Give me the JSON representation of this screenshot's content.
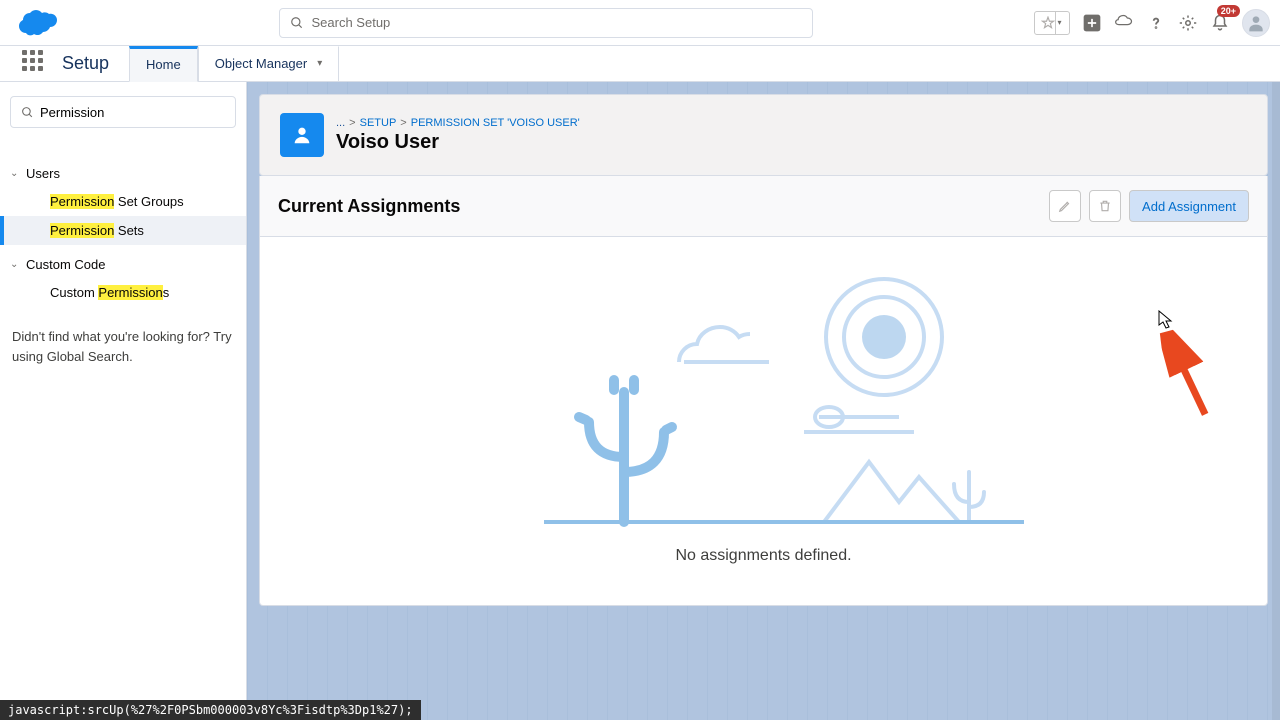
{
  "header": {
    "search_placeholder": "Search Setup",
    "notification_badge": "20+"
  },
  "nav": {
    "app_name": "Setup",
    "tabs": {
      "home": "Home",
      "object_manager": "Object Manager"
    }
  },
  "sidebar": {
    "filter_value": "Permission",
    "groups": {
      "users": {
        "label": "Users",
        "items": [
          "Permission Set Groups",
          "Permission Sets"
        ]
      },
      "custom_code": {
        "label": "Custom Code",
        "items": [
          "Custom Permissions"
        ]
      }
    },
    "hint": "Didn't find what you're looking for? Try using Global Search."
  },
  "page": {
    "breadcrumb": {
      "root": "...",
      "setup": "SETUP",
      "parent": "PERMISSION SET 'VOISO USER'"
    },
    "title": "Voiso User",
    "panel_title": "Current Assignments",
    "add_button": "Add Assignment",
    "empty_message": "No assignments defined."
  },
  "status_text": "javascript:srcUp(%27%2F0PSbm000003v8Yc%3Fisdtp%3Dp1%27);"
}
